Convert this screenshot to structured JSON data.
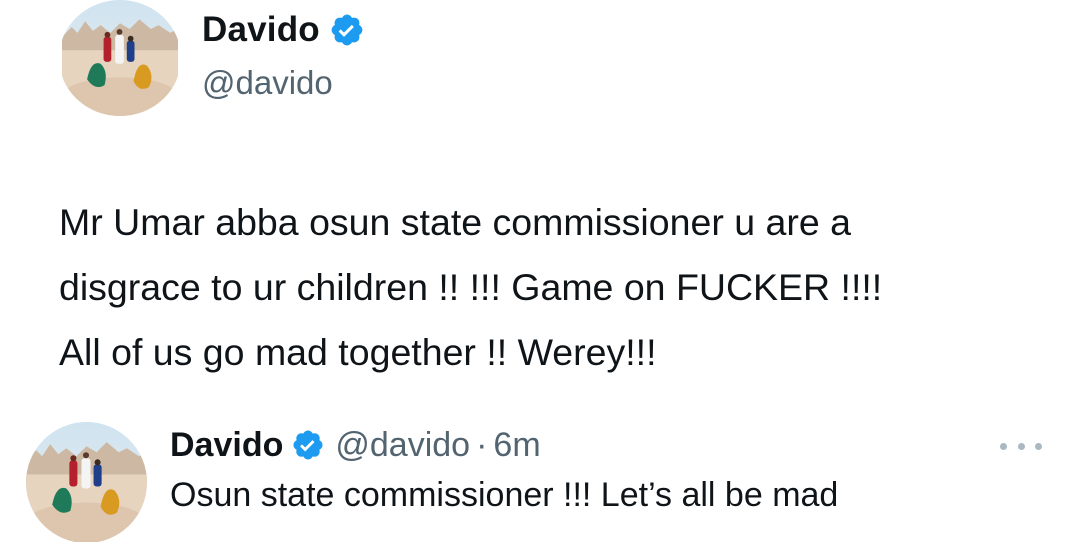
{
  "tweet": {
    "author": {
      "display_name": "Davido",
      "handle": "@davido",
      "verified": true,
      "avatar_icon": "desert-figures-avatar"
    },
    "text": "Mr Umar abba osun state  commissioner u are a\ndisgrace to ur children !! !!! Game on FUCKER !!!!\nAll of us go mad together !! Werey!!!"
  },
  "quoted": {
    "author": {
      "display_name": "Davido",
      "handle": "@davido",
      "verified": true,
      "avatar_icon": "desert-figures-avatar"
    },
    "separator": "·",
    "timestamp": "6m",
    "text": "Osun state commissioner !!! Let’s all be mad",
    "more_icon": "more-horizontal-icon"
  },
  "colors": {
    "text_primary": "#0f1419",
    "text_secondary": "#536471",
    "verified_blue": "#1d9bf0",
    "more_dots": "#aab8c2"
  }
}
